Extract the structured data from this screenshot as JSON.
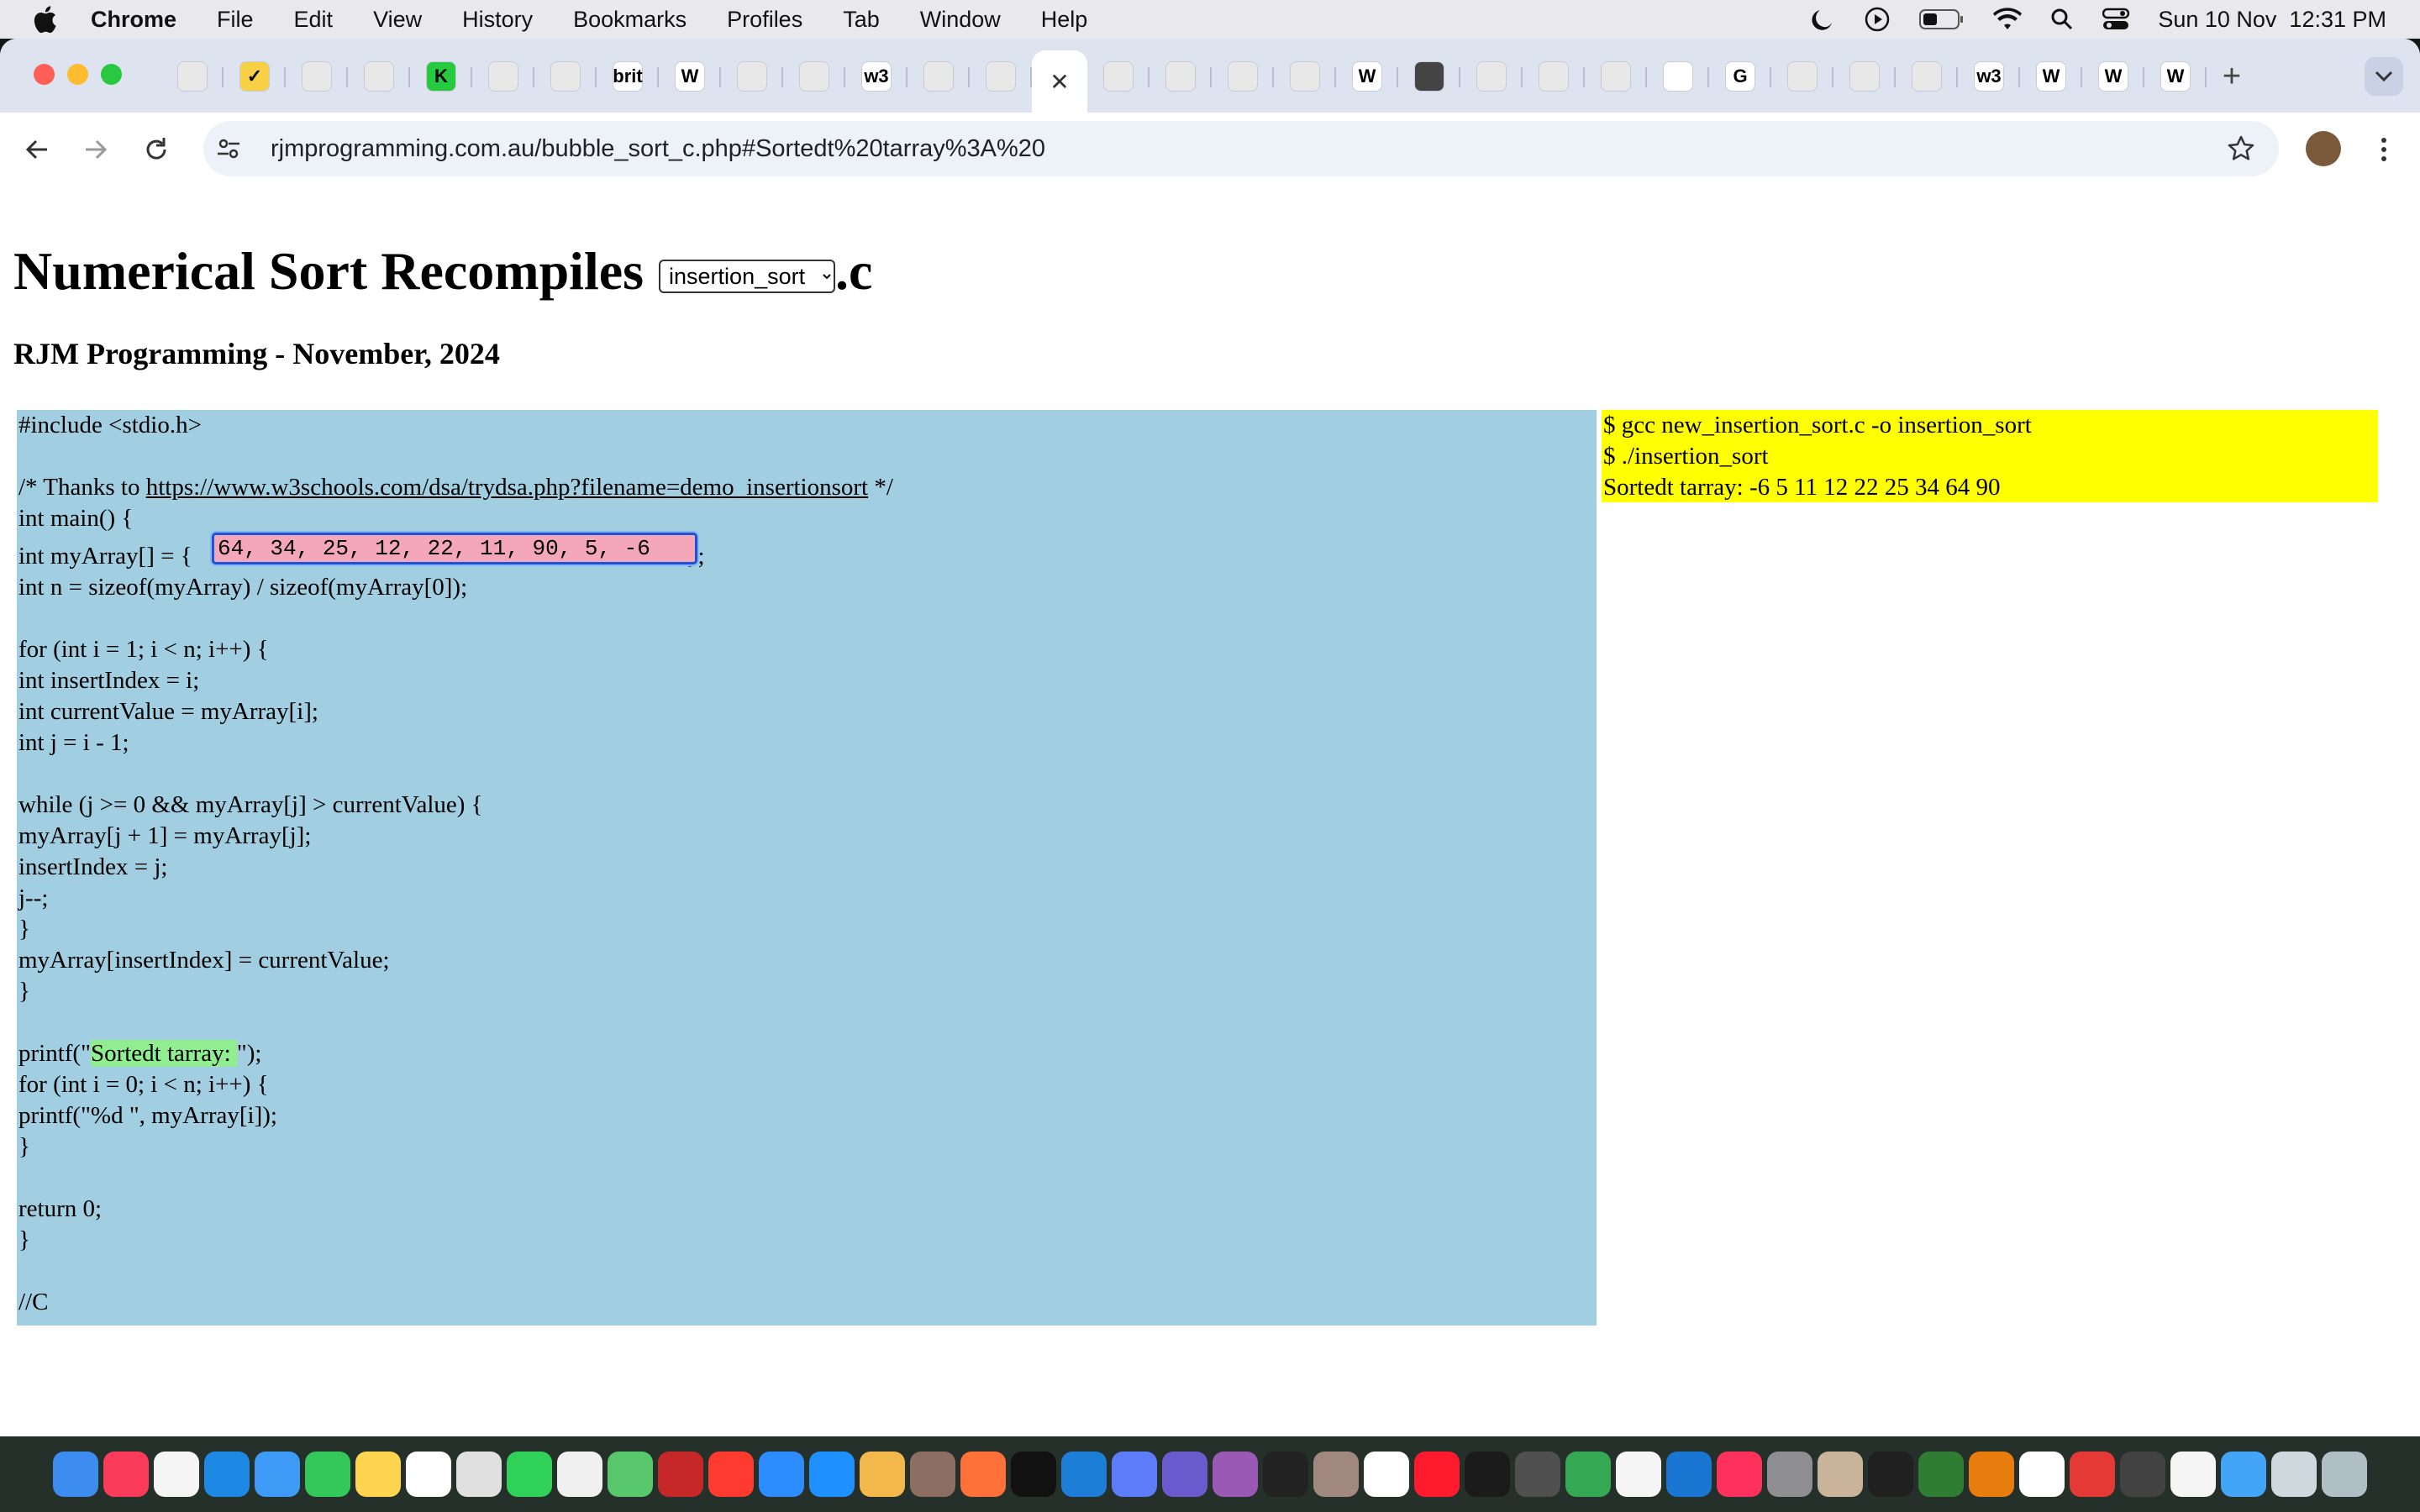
{
  "menubar": {
    "app_name": "Chrome",
    "items": [
      "File",
      "Edit",
      "View",
      "History",
      "Bookmarks",
      "Profiles",
      "Tab",
      "Window",
      "Help"
    ],
    "datetime": "Sun 10 Nov  12:31 PM"
  },
  "browser": {
    "tabs": [
      {
        "icon": "rjm-favicon",
        "label": "",
        "color": "#e8e8e8"
      },
      {
        "icon": "check-favicon",
        "label": "✓",
        "color": "#f7d046"
      },
      {
        "icon": "rjm-favicon",
        "label": "",
        "color": "#e8e8e8"
      },
      {
        "icon": "rjm-favicon",
        "label": "",
        "color": "#e8e8e8"
      },
      {
        "icon": "k-favicon",
        "label": "K",
        "color": "#27c93f"
      },
      {
        "icon": "rjm-favicon",
        "label": "",
        "color": "#e8e8e8"
      },
      {
        "icon": "rjm-favicon",
        "label": "",
        "color": "#e8e8e8"
      },
      {
        "icon": "britbox-favicon",
        "label": "brit",
        "color": "#ffffff"
      },
      {
        "icon": "wikipedia-favicon",
        "label": "W",
        "color": "#ffffff"
      },
      {
        "icon": "rjm-favicon",
        "label": "",
        "color": "#e8e8e8"
      },
      {
        "icon": "rjm-favicon",
        "label": "",
        "color": "#e8e8e8"
      },
      {
        "icon": "w3schools-favicon",
        "label": "w3",
        "color": "#ffffff"
      },
      {
        "icon": "rjm-favicon",
        "label": "",
        "color": "#e8e8e8"
      },
      {
        "icon": "rjm-favicon",
        "label": "",
        "color": "#e8e8e8"
      },
      {
        "icon": "close-icon",
        "label": "✕",
        "color": "#ffffff",
        "active": true
      },
      {
        "icon": "rjm-favicon",
        "label": "",
        "color": "#e8e8e8"
      },
      {
        "icon": "rjm-favicon",
        "label": "",
        "color": "#e8e8e8"
      },
      {
        "icon": "rjm-favicon",
        "label": "",
        "color": "#e8e8e8"
      },
      {
        "icon": "rjm-favicon",
        "label": "",
        "color": "#e8e8e8"
      },
      {
        "icon": "wordpress-favicon",
        "label": "W",
        "color": "#ffffff"
      },
      {
        "icon": "github-favicon",
        "label": "",
        "color": "#444444"
      },
      {
        "icon": "rjm-favicon",
        "label": "",
        "color": "#e8e8e8"
      },
      {
        "icon": "rjm-favicon",
        "label": "",
        "color": "#e8e8e8"
      },
      {
        "icon": "rjm-favicon",
        "label": "",
        "color": "#e8e8e8"
      },
      {
        "icon": "blank-favicon",
        "label": "",
        "color": "#ffffff"
      },
      {
        "icon": "google-favicon",
        "label": "G",
        "color": "#ffffff"
      },
      {
        "icon": "rjm-favicon",
        "label": "",
        "color": "#e8e8e8"
      },
      {
        "icon": "rjm-favicon",
        "label": "",
        "color": "#e8e8e8"
      },
      {
        "icon": "rjm-favicon",
        "label": "",
        "color": "#e8e8e8"
      },
      {
        "icon": "w3schools-favicon",
        "label": "w3",
        "color": "#ffffff"
      },
      {
        "icon": "wordpress-favicon",
        "label": "W",
        "color": "#ffffff"
      },
      {
        "icon": "wordpress-favicon",
        "label": "W",
        "color": "#ffffff"
      },
      {
        "icon": "wordpress-favicon",
        "label": "W",
        "color": "#ffffff"
      }
    ],
    "new_tab_label": "+",
    "url": "rjmprogramming.com.au/bubble_sort_c.php#Sortedt%20tarray%3A%20"
  },
  "page": {
    "title": "Numerical Sort Recompiles",
    "select_value": "insertion_sort",
    "title_suffix": ".c",
    "subtitle": "RJM Programming - November, 2024",
    "code": {
      "include_line": "#include <stdio.h>",
      "thanks_prefix": "/* Thanks to ",
      "thanks_link": "https://www.w3schools.com/dsa/trydsa.php?filename=demo_insertionsort",
      "thanks_suffix": " */",
      "main_line": "int main() {",
      "array_prefix": "int myArray[] = {",
      "array_value": "64, 34, 25, 12, 22, 11, 90, 5, -6",
      "array_suffix": "};",
      "n_line": "int n = sizeof(myArray) / sizeof(myArray[0]);",
      "for1": "for (int i = 1; i < n; i++) {",
      "insert_index": "int insertIndex = i;",
      "current_value": "int currentValue = myArray[i];",
      "j_line": "int j = i - 1;",
      "while_line": "while (j >= 0 && myArray[j] > currentValue) {",
      "shift_line": "myArray[j + 1] = myArray[j];",
      "insert_j": "insertIndex = j;",
      "j_dec": "j--;",
      "close1": "}",
      "assign_line": "myArray[insertIndex] = currentValue;",
      "close2": "}",
      "printf_prefix": "printf(\"",
      "printf_highlight": "Sortedt tarray: ",
      "printf_suffix": "\");",
      "for2": "for (int i = 0; i < n; i++) {",
      "printf_d": "printf(\"%d \", myArray[i]);",
      "close3": "}",
      "return_line": "return 0;",
      "close4": "}",
      "comment_c": "//C"
    },
    "output": {
      "line1": "$ gcc new_insertion_sort.c -o insertion_sort",
      "line2": "$ ./insertion_sort",
      "line3": "Sortedt tarray: -6 5 11 12 22 25 34 64 90"
    }
  },
  "dock": {
    "icons": [
      {
        "name": "finder-icon",
        "color": "#3d8cf0"
      },
      {
        "name": "music-icon",
        "color": "#fa3c5a"
      },
      {
        "name": "reminders-icon",
        "color": "#f5f5f5"
      },
      {
        "name": "safari-icon",
        "color": "#1e88e5"
      },
      {
        "name": "mail-icon",
        "color": "#3d9bf7"
      },
      {
        "name": "messages-icon",
        "color": "#34c759"
      },
      {
        "name": "notes-icon",
        "color": "#ffd54f"
      },
      {
        "name": "freeform-icon",
        "color": "#ffffff"
      },
      {
        "name": "launchpad-icon",
        "color": "#e0e0e0"
      },
      {
        "name": "facetime-icon",
        "color": "#30d158"
      },
      {
        "name": "file-icon",
        "color": "#f0f0f0"
      },
      {
        "name": "maps-icon",
        "color": "#58c76b"
      },
      {
        "name": "filezilla-icon",
        "color": "#c62828"
      },
      {
        "name": "news-icon",
        "color": "#ff3b30"
      },
      {
        "name": "zoom-icon",
        "color": "#2d8cff"
      },
      {
        "name": "appstore-icon",
        "color": "#1e90ff"
      },
      {
        "name": "photos-icon",
        "color": "#f2b84b"
      },
      {
        "name": "preview-icon",
        "color": "#8d6e63"
      },
      {
        "name": "firefox-icon",
        "color": "#ff7139"
      },
      {
        "name": "appletv-icon",
        "color": "#111111"
      },
      {
        "name": "xcode-icon",
        "color": "#1c7ed6"
      },
      {
        "name": "screen-icon",
        "color": "#5c7cfa"
      },
      {
        "name": "bbedit-icon",
        "color": "#6a5acd"
      },
      {
        "name": "podcasts-icon",
        "color": "#9b59b6"
      },
      {
        "name": "terminal-icon",
        "color": "#222222"
      },
      {
        "name": "keychain-icon",
        "color": "#a1887f"
      },
      {
        "name": "calendar-icon",
        "color": "#ffffff"
      },
      {
        "name": "opera-icon",
        "color": "#ff1b2d"
      },
      {
        "name": "console-icon",
        "color": "#1b1b1b"
      },
      {
        "name": "calculator-icon",
        "color": "#505050"
      },
      {
        "name": "chrome-icon",
        "color": "#34a853"
      },
      {
        "name": "document-icon",
        "color": "#f5f5f5"
      },
      {
        "name": "quicktime-icon",
        "color": "#1976d2"
      },
      {
        "name": "intellij-icon",
        "color": "#fe315d"
      },
      {
        "name": "settings-icon",
        "color": "#8e8e93"
      },
      {
        "name": "gimp-icon",
        "color": "#c9b49b"
      },
      {
        "name": "activity-icon",
        "color": "#202020"
      },
      {
        "name": "inkscape-icon",
        "color": "#2e7d32"
      },
      {
        "name": "blender-icon",
        "color": "#e87d0d"
      },
      {
        "name": "mastodon-icon",
        "color": "#ffffff"
      },
      {
        "name": "filemaker-icon",
        "color": "#e53935"
      },
      {
        "name": "x11-icon",
        "color": "#424242"
      },
      {
        "name": "pages-icon",
        "color": "#f5f5f5"
      },
      {
        "name": "safari-dev-icon",
        "color": "#42a5f5"
      },
      {
        "name": "folder-icon",
        "color": "#cfd8dc"
      },
      {
        "name": "trash-icon",
        "color": "#b0bec5"
      }
    ]
  }
}
